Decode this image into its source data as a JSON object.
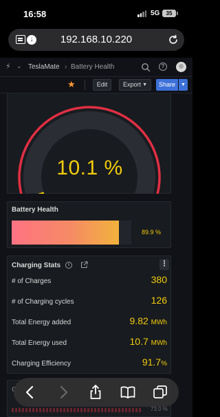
{
  "status_bar": {
    "time": "16:58",
    "network": "5G",
    "battery": "35"
  },
  "browser": {
    "url": "192.168.10.220"
  },
  "nav": {
    "breadcrumb_app": "TeslaMate",
    "breadcrumb_separator": "›",
    "breadcrumb_page": "Battery Health"
  },
  "toolbar": {
    "edit_label": "Edit",
    "export_label": "Export",
    "share_label": "Share"
  },
  "gauge": {
    "value_text": "10.1 %",
    "value_fraction": 0.101,
    "colors": {
      "red": "#e02f44",
      "yellow": "#f2cc0c",
      "green": "#56a64b",
      "track": "#2a2d33"
    }
  },
  "battery_health": {
    "title": "Battery Health",
    "value_text": "89.9 %",
    "value_percent": 89.9
  },
  "charging_stats": {
    "title": "Charging Stats",
    "rows": [
      {
        "label": "# of Charges",
        "value": "380",
        "unit": ""
      },
      {
        "label": "# of Charging cycles",
        "value": "126",
        "unit": ""
      },
      {
        "label": "Total Energy added",
        "value": "9.82",
        "unit": "MWh"
      },
      {
        "label": "Total Energy used",
        "value": "10.7",
        "unit": "MWh"
      },
      {
        "label": "Charging Efficiency",
        "value": "91.7",
        "unit": "%"
      }
    ]
  },
  "partial_panel": {
    "title_fragment": "C",
    "side_text": "73.0 %"
  },
  "colors": {
    "accent_value": "#f2cc0c",
    "share_button": "#3d71d9",
    "star": "#ff9830",
    "panel_bg": "#181b1f",
    "page_bg": "#111217"
  },
  "icons": [
    "reader-icon",
    "download-icon",
    "reload-icon",
    "grafana-logo-icon",
    "search-icon",
    "help-icon",
    "avatar",
    "star-icon",
    "info-icon",
    "external-link-icon",
    "menu-icon",
    "back-icon",
    "forward-icon",
    "share-icon",
    "bookmarks-icon",
    "tabs-icon"
  ]
}
